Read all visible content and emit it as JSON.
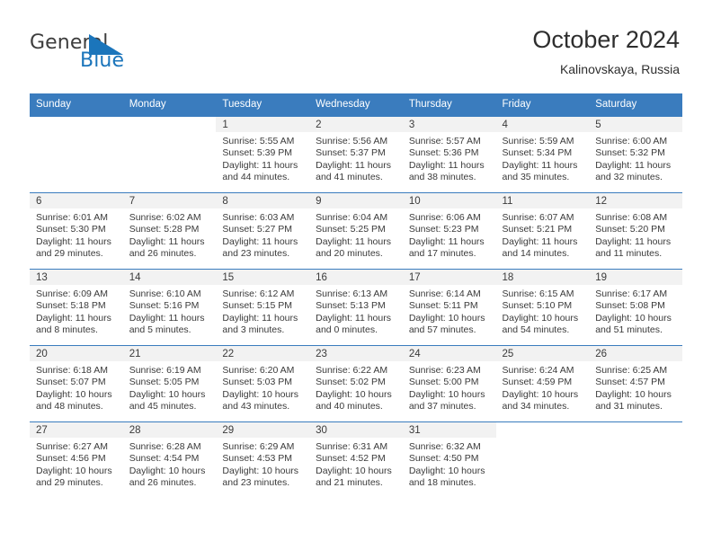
{
  "brand": {
    "name_part1": "General",
    "name_part2": "Blue",
    "logo_icon": "triangle-mark",
    "accent_color": "#1b75bb"
  },
  "header": {
    "title": "October 2024",
    "subtitle": "Kalinovskaya, Russia"
  },
  "calendar": {
    "header_bg": "#3a7cbe",
    "weekdays": [
      "Sunday",
      "Monday",
      "Tuesday",
      "Wednesday",
      "Thursday",
      "Friday",
      "Saturday"
    ],
    "weeks": [
      [
        {
          "day": "",
          "sunrise": "",
          "sunset": "",
          "daylight": "",
          "blank": true
        },
        {
          "day": "",
          "sunrise": "",
          "sunset": "",
          "daylight": "",
          "blank": true
        },
        {
          "day": "1",
          "sunrise": "Sunrise: 5:55 AM",
          "sunset": "Sunset: 5:39 PM",
          "daylight": "Daylight: 11 hours and 44 minutes."
        },
        {
          "day": "2",
          "sunrise": "Sunrise: 5:56 AM",
          "sunset": "Sunset: 5:37 PM",
          "daylight": "Daylight: 11 hours and 41 minutes."
        },
        {
          "day": "3",
          "sunrise": "Sunrise: 5:57 AM",
          "sunset": "Sunset: 5:36 PM",
          "daylight": "Daylight: 11 hours and 38 minutes."
        },
        {
          "day": "4",
          "sunrise": "Sunrise: 5:59 AM",
          "sunset": "Sunset: 5:34 PM",
          "daylight": "Daylight: 11 hours and 35 minutes."
        },
        {
          "day": "5",
          "sunrise": "Sunrise: 6:00 AM",
          "sunset": "Sunset: 5:32 PM",
          "daylight": "Daylight: 11 hours and 32 minutes."
        }
      ],
      [
        {
          "day": "6",
          "sunrise": "Sunrise: 6:01 AM",
          "sunset": "Sunset: 5:30 PM",
          "daylight": "Daylight: 11 hours and 29 minutes."
        },
        {
          "day": "7",
          "sunrise": "Sunrise: 6:02 AM",
          "sunset": "Sunset: 5:28 PM",
          "daylight": "Daylight: 11 hours and 26 minutes."
        },
        {
          "day": "8",
          "sunrise": "Sunrise: 6:03 AM",
          "sunset": "Sunset: 5:27 PM",
          "daylight": "Daylight: 11 hours and 23 minutes."
        },
        {
          "day": "9",
          "sunrise": "Sunrise: 6:04 AM",
          "sunset": "Sunset: 5:25 PM",
          "daylight": "Daylight: 11 hours and 20 minutes."
        },
        {
          "day": "10",
          "sunrise": "Sunrise: 6:06 AM",
          "sunset": "Sunset: 5:23 PM",
          "daylight": "Daylight: 11 hours and 17 minutes."
        },
        {
          "day": "11",
          "sunrise": "Sunrise: 6:07 AM",
          "sunset": "Sunset: 5:21 PM",
          "daylight": "Daylight: 11 hours and 14 minutes."
        },
        {
          "day": "12",
          "sunrise": "Sunrise: 6:08 AM",
          "sunset": "Sunset: 5:20 PM",
          "daylight": "Daylight: 11 hours and 11 minutes."
        }
      ],
      [
        {
          "day": "13",
          "sunrise": "Sunrise: 6:09 AM",
          "sunset": "Sunset: 5:18 PM",
          "daylight": "Daylight: 11 hours and 8 minutes."
        },
        {
          "day": "14",
          "sunrise": "Sunrise: 6:10 AM",
          "sunset": "Sunset: 5:16 PM",
          "daylight": "Daylight: 11 hours and 5 minutes."
        },
        {
          "day": "15",
          "sunrise": "Sunrise: 6:12 AM",
          "sunset": "Sunset: 5:15 PM",
          "daylight": "Daylight: 11 hours and 3 minutes."
        },
        {
          "day": "16",
          "sunrise": "Sunrise: 6:13 AM",
          "sunset": "Sunset: 5:13 PM",
          "daylight": "Daylight: 11 hours and 0 minutes."
        },
        {
          "day": "17",
          "sunrise": "Sunrise: 6:14 AM",
          "sunset": "Sunset: 5:11 PM",
          "daylight": "Daylight: 10 hours and 57 minutes."
        },
        {
          "day": "18",
          "sunrise": "Sunrise: 6:15 AM",
          "sunset": "Sunset: 5:10 PM",
          "daylight": "Daylight: 10 hours and 54 minutes."
        },
        {
          "day": "19",
          "sunrise": "Sunrise: 6:17 AM",
          "sunset": "Sunset: 5:08 PM",
          "daylight": "Daylight: 10 hours and 51 minutes."
        }
      ],
      [
        {
          "day": "20",
          "sunrise": "Sunrise: 6:18 AM",
          "sunset": "Sunset: 5:07 PM",
          "daylight": "Daylight: 10 hours and 48 minutes."
        },
        {
          "day": "21",
          "sunrise": "Sunrise: 6:19 AM",
          "sunset": "Sunset: 5:05 PM",
          "daylight": "Daylight: 10 hours and 45 minutes."
        },
        {
          "day": "22",
          "sunrise": "Sunrise: 6:20 AM",
          "sunset": "Sunset: 5:03 PM",
          "daylight": "Daylight: 10 hours and 43 minutes."
        },
        {
          "day": "23",
          "sunrise": "Sunrise: 6:22 AM",
          "sunset": "Sunset: 5:02 PM",
          "daylight": "Daylight: 10 hours and 40 minutes."
        },
        {
          "day": "24",
          "sunrise": "Sunrise: 6:23 AM",
          "sunset": "Sunset: 5:00 PM",
          "daylight": "Daylight: 10 hours and 37 minutes."
        },
        {
          "day": "25",
          "sunrise": "Sunrise: 6:24 AM",
          "sunset": "Sunset: 4:59 PM",
          "daylight": "Daylight: 10 hours and 34 minutes."
        },
        {
          "day": "26",
          "sunrise": "Sunrise: 6:25 AM",
          "sunset": "Sunset: 4:57 PM",
          "daylight": "Daylight: 10 hours and 31 minutes."
        }
      ],
      [
        {
          "day": "27",
          "sunrise": "Sunrise: 6:27 AM",
          "sunset": "Sunset: 4:56 PM",
          "daylight": "Daylight: 10 hours and 29 minutes."
        },
        {
          "day": "28",
          "sunrise": "Sunrise: 6:28 AM",
          "sunset": "Sunset: 4:54 PM",
          "daylight": "Daylight: 10 hours and 26 minutes."
        },
        {
          "day": "29",
          "sunrise": "Sunrise: 6:29 AM",
          "sunset": "Sunset: 4:53 PM",
          "daylight": "Daylight: 10 hours and 23 minutes."
        },
        {
          "day": "30",
          "sunrise": "Sunrise: 6:31 AM",
          "sunset": "Sunset: 4:52 PM",
          "daylight": "Daylight: 10 hours and 21 minutes."
        },
        {
          "day": "31",
          "sunrise": "Sunrise: 6:32 AM",
          "sunset": "Sunset: 4:50 PM",
          "daylight": "Daylight: 10 hours and 18 minutes."
        },
        {
          "day": "",
          "sunrise": "",
          "sunset": "",
          "daylight": "",
          "blank": true
        },
        {
          "day": "",
          "sunrise": "",
          "sunset": "",
          "daylight": "",
          "blank": true
        }
      ]
    ]
  }
}
